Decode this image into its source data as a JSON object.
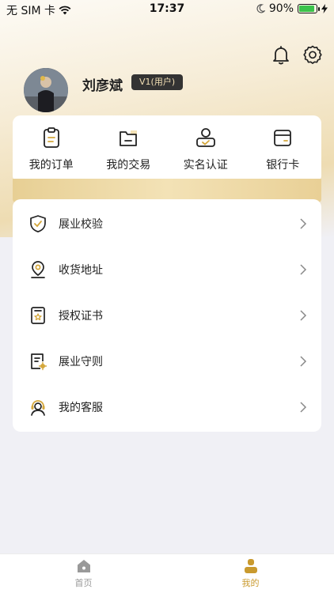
{
  "status_bar": {
    "carrier": "无 SIM 卡",
    "time": "17:37",
    "battery_percent": "90%",
    "battery_level": 0.9
  },
  "profile": {
    "name": "刘彦斌",
    "level": "V1(用户)"
  },
  "quick_actions": [
    {
      "label": "我的订单",
      "icon": "clipboard-icon"
    },
    {
      "label": "我的交易",
      "icon": "folder-icon"
    },
    {
      "label": "实名认证",
      "icon": "id-user-icon"
    },
    {
      "label": "银行卡",
      "icon": "bank-card-icon"
    }
  ],
  "menu": [
    {
      "label": "展业校验",
      "icon": "shield-check-icon"
    },
    {
      "label": "收货地址",
      "icon": "location-pin-icon"
    },
    {
      "label": "授权证书",
      "icon": "certificate-icon"
    },
    {
      "label": "展业守则",
      "icon": "rules-document-icon"
    },
    {
      "label": "我的客服",
      "icon": "customer-service-icon"
    }
  ],
  "tabs": [
    {
      "label": "首页",
      "icon": "home-icon",
      "active": false
    },
    {
      "label": "我的",
      "icon": "profile-icon",
      "active": true
    }
  ],
  "colors": {
    "accent": "#c99a2e",
    "badge_bg": "#333333",
    "badge_text": "#f2dfb4",
    "battery": "#3bc34a"
  }
}
